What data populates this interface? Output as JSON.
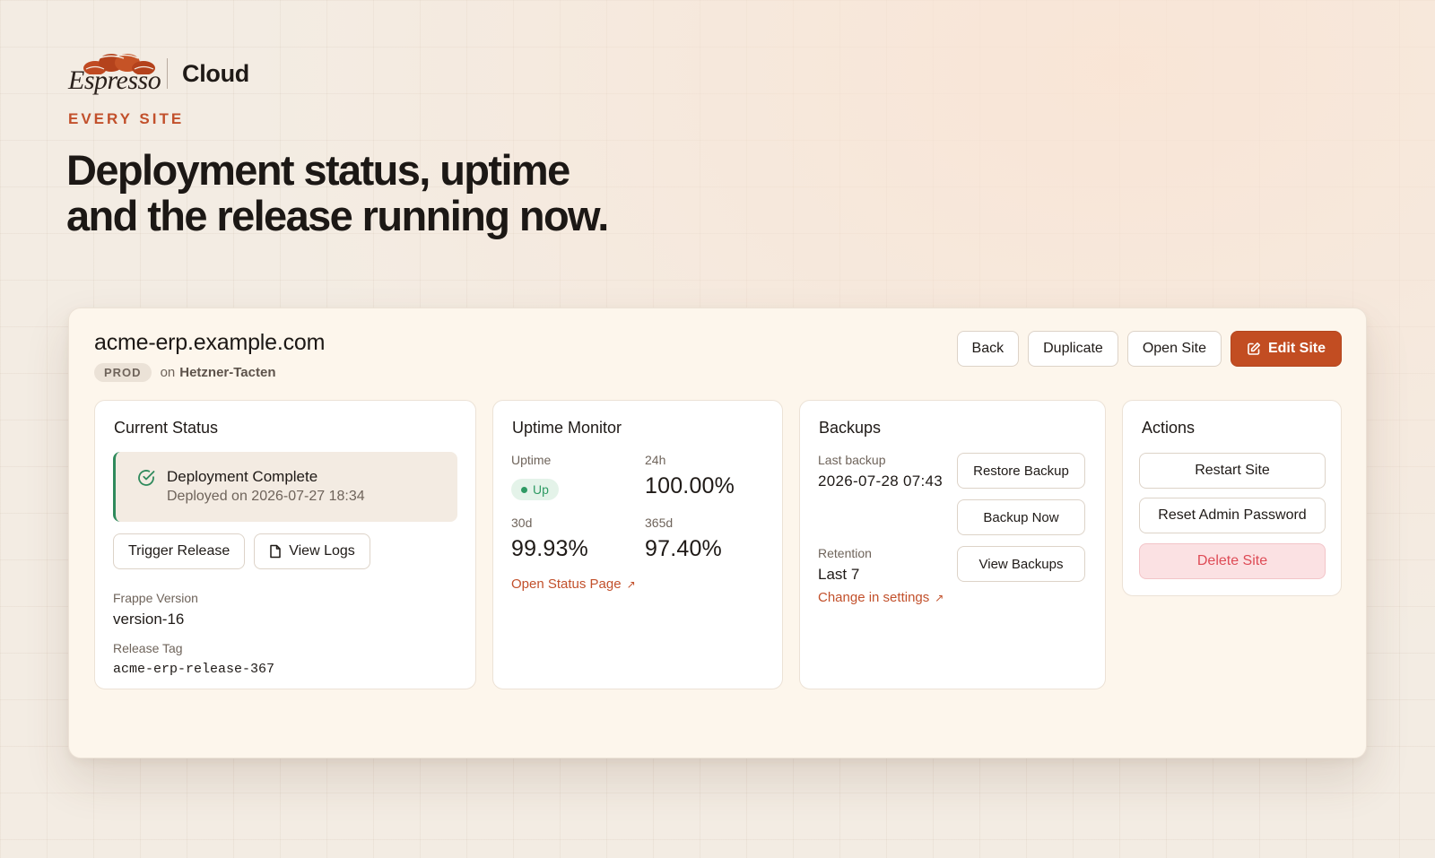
{
  "brand": {
    "logo_text": "Espresso",
    "product": "Cloud"
  },
  "hero": {
    "eyebrow": "EVERY SITE",
    "headline_line1": "Deployment status, uptime",
    "headline_line2": "and the release running now."
  },
  "site": {
    "name": "acme-erp.example.com",
    "environment": "PROD",
    "on_label": "on",
    "server": "Hetzner-Tacten"
  },
  "header_actions": {
    "back": "Back",
    "duplicate": "Duplicate",
    "open_site": "Open Site",
    "edit_site": "Edit Site"
  },
  "current_status": {
    "title": "Current Status",
    "status_title": "Deployment Complete",
    "status_sub": "Deployed on 2026-07-27 18:34",
    "trigger_release": "Trigger Release",
    "view_logs": "View Logs",
    "frappe_version_label": "Frappe Version",
    "frappe_version": "version-16",
    "release_tag_label": "Release Tag",
    "release_tag": "acme-erp-release-367"
  },
  "uptime": {
    "title": "Uptime Monitor",
    "uptime_label": "Uptime",
    "status": "Up",
    "d24_label": "24h",
    "d24_value": "100.00%",
    "d30_label": "30d",
    "d30_value": "99.93%",
    "d365_label": "365d",
    "d365_value": "97.40%",
    "status_link": "Open Status Page"
  },
  "backups": {
    "title": "Backups",
    "last_backup_label": "Last backup",
    "last_backup": "2026-07-28 07:43",
    "retention_label": "Retention",
    "retention": "Last 7",
    "settings_link": "Change in settings",
    "restore": "Restore Backup",
    "backup_now": "Backup Now",
    "view_backups": "View Backups"
  },
  "actions": {
    "title": "Actions",
    "restart": "Restart Site",
    "reset_password": "Reset Admin Password",
    "delete": "Delete Site"
  },
  "colors": {
    "accent": "#c24d22",
    "success": "#2f8a5c",
    "danger": "#de4b56",
    "background": "#f3ece3",
    "panel": "#fdf6ec"
  },
  "icons": {
    "logo": "coffee-bean-logo-icon",
    "check": "check-circle-icon",
    "logs": "file-icon",
    "edit": "edit-icon",
    "external": "arrow-up-right-icon"
  }
}
